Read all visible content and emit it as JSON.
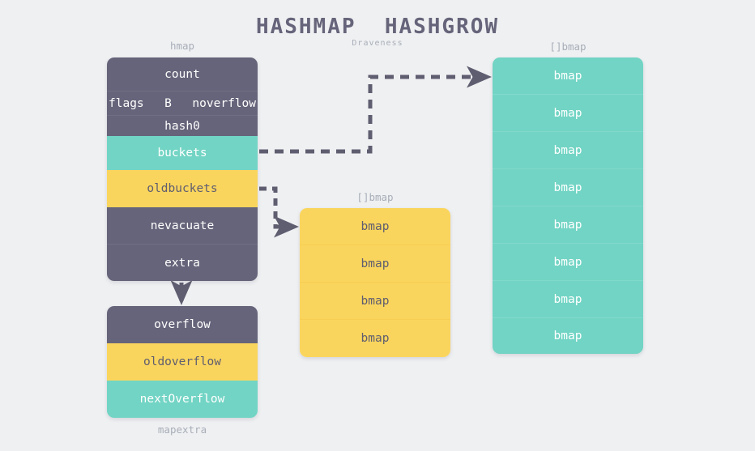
{
  "header": {
    "title": "HASHMAP  HASHGROW",
    "subtitle": "Draveness"
  },
  "colors": {
    "background": "#eff0f2",
    "dark": "#66647a",
    "teal": "#72d4c4",
    "yellow": "#fad55d",
    "label": "#a8aeb8",
    "arrow": "#5f5d70"
  },
  "hmap": {
    "label": "hmap",
    "rows": [
      {
        "text": "count",
        "fill": "dark"
      },
      {
        "fill": "dark",
        "cells": [
          "flags",
          "B",
          "noverflow"
        ]
      },
      {
        "text": "hash0",
        "fill": "dark"
      },
      {
        "text": "buckets",
        "fill": "teal"
      },
      {
        "text": "oldbuckets",
        "fill": "yellow"
      },
      {
        "text": "nevacuate",
        "fill": "dark"
      },
      {
        "text": "extra",
        "fill": "dark"
      }
    ]
  },
  "mapextra": {
    "label": "mapextra",
    "rows": [
      {
        "text": "overflow",
        "fill": "dark"
      },
      {
        "text": "oldoverflow",
        "fill": "yellow"
      },
      {
        "text": "nextOverflow",
        "fill": "teal"
      }
    ]
  },
  "old_buckets_array": {
    "label": "[]bmap",
    "fill": "yellow",
    "rows": [
      {
        "text": "bmap"
      },
      {
        "text": "bmap"
      },
      {
        "text": "bmap"
      },
      {
        "text": "bmap"
      }
    ]
  },
  "new_buckets_array": {
    "label": "[]bmap",
    "fill": "teal",
    "rows": [
      {
        "text": "bmap"
      },
      {
        "text": "bmap"
      },
      {
        "text": "bmap"
      },
      {
        "text": "bmap"
      },
      {
        "text": "bmap"
      },
      {
        "text": "bmap"
      },
      {
        "text": "bmap"
      },
      {
        "text": "bmap"
      }
    ]
  },
  "connections": [
    {
      "name": "buckets-to-new-bmap-array",
      "from": "hmap.buckets",
      "to": "new_buckets_array"
    },
    {
      "name": "oldbuckets-to-old-bmap-array",
      "from": "hmap.oldbuckets",
      "to": "old_buckets_array"
    },
    {
      "name": "extra-to-mapextra",
      "from": "hmap.extra",
      "to": "mapextra"
    }
  ]
}
